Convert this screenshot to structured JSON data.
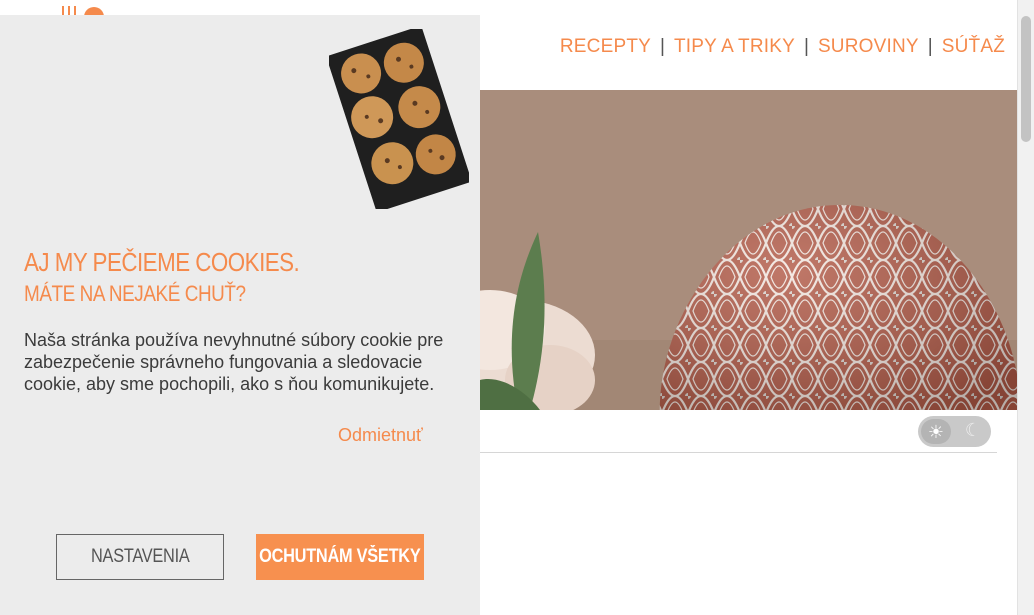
{
  "nav": {
    "items": [
      "RECEPTY",
      "TIPY A TRIKY",
      "SUROVINY",
      "SÚŤAŽ"
    ],
    "separator": "|"
  },
  "colors": {
    "accent": "#f58a4c",
    "panel": "#ececec",
    "text": "#3b3b3b"
  },
  "cookie_banner": {
    "title": "AJ MY PEČIEME COOKIES.",
    "subtitle": "MÁTE NA NEJAKÉ CHUŤ?",
    "body": "Naša stránka používa nevyhnutné súbory cookie pre zabezpečenie správneho fungovania a sledovacie cookie, aby sme pochopili, ako s ňou komunikujete.",
    "reject_label": "Odmietnuť",
    "settings_label": "NASTAVENIA",
    "accept_label": "OCHUTNÁM VŠETKY"
  },
  "theme_toggle": {
    "light_icon": "sun-icon",
    "dark_icon": "moon-icon",
    "state": "light"
  }
}
